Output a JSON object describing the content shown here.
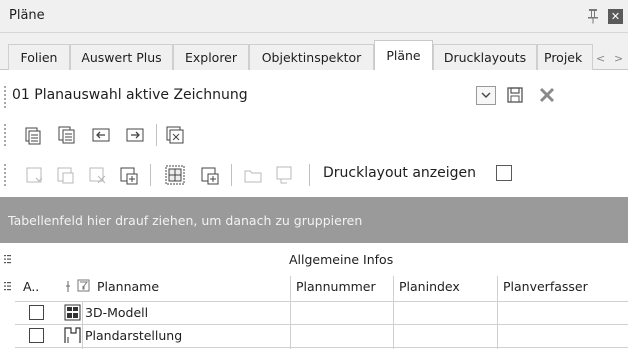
{
  "window": {
    "title": "Pläne"
  },
  "tabs": [
    {
      "label": "Folien"
    },
    {
      "label": "Auswert Plus"
    },
    {
      "label": "Explorer"
    },
    {
      "label": "Objektinspektor"
    },
    {
      "label": "Pläne"
    },
    {
      "label": "Drucklayouts"
    },
    {
      "label": "Projek"
    }
  ],
  "active_tab": "Pläne",
  "selection": {
    "value": "01 Planauswahl aktive Zeichnung"
  },
  "toolbar2": {
    "drucklayout_label": "Drucklayout anzeigen",
    "drucklayout_checked": false
  },
  "grid": {
    "group_hint": "Tabellenfeld hier drauf ziehen, um danach zu gruppieren",
    "band_label": "Allgemeine Infos",
    "columns": {
      "active": "A..",
      "planname": "Planname",
      "plannummer": "Plannummer",
      "planindex": "Planindex",
      "planverfasser": "Planverfasser"
    },
    "rows": [
      {
        "name": "3D-Modell",
        "icon": "model-3d-icon"
      },
      {
        "name": "Plandarstellung",
        "icon": "plan-view-icon"
      }
    ]
  }
}
